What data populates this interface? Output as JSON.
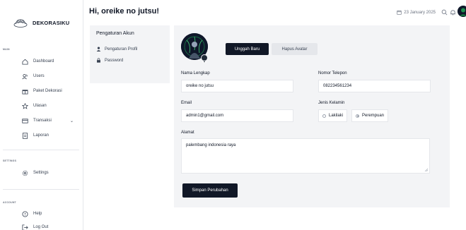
{
  "brand": {
    "name": "DEKORASIKU"
  },
  "sidebar": {
    "sections": [
      {
        "label": "MAIN"
      },
      {
        "label": "SETTINGS"
      },
      {
        "label": "ACCOUNT"
      }
    ],
    "items": [
      {
        "label": "Dashboard",
        "icon": "home-icon"
      },
      {
        "label": "Users",
        "icon": "users-icon"
      },
      {
        "label": "Paket Dekorasi",
        "icon": "gift-icon"
      },
      {
        "label": "Ulasan",
        "icon": "star-icon"
      },
      {
        "label": "Transaksi",
        "icon": "card-icon"
      },
      {
        "label": "Laporan",
        "icon": "report-icon"
      },
      {
        "label": "Settings",
        "icon": "gear-icon"
      },
      {
        "label": "Help",
        "icon": "help-icon"
      },
      {
        "label": "Log Out",
        "icon": "logout-icon"
      }
    ]
  },
  "header": {
    "greeting": "Hi, oreike no jutsu!",
    "date": "23 January 2025"
  },
  "settings_nav": {
    "title": "Pengaturan Akun",
    "links": [
      {
        "label": "Pengaturan Profil",
        "icon": "user-icon"
      },
      {
        "label": "Password",
        "icon": "lock-icon"
      }
    ]
  },
  "profile_form": {
    "upload_label": "Unggah Baru",
    "remove_label": "Hapus Avatar",
    "name_label": "Nama Lengkap",
    "name_value": "oreike no jutsu",
    "phone_label": "Nomor Telepon",
    "phone_value": "082234561234",
    "email_label": "Email",
    "email_value": "admin1@gmail.com",
    "gender_label": "Jenis Kelamin",
    "gender_options": [
      "Lakilaki",
      "Perempuan"
    ],
    "gender_selected": "Perempuan",
    "address_label": "Alamat",
    "address_value": "palembang indonesia raya",
    "save_label": "Simpan Perubahan"
  },
  "colors": {
    "primary_button": "#111827",
    "card_background": "#f3f4f6"
  }
}
